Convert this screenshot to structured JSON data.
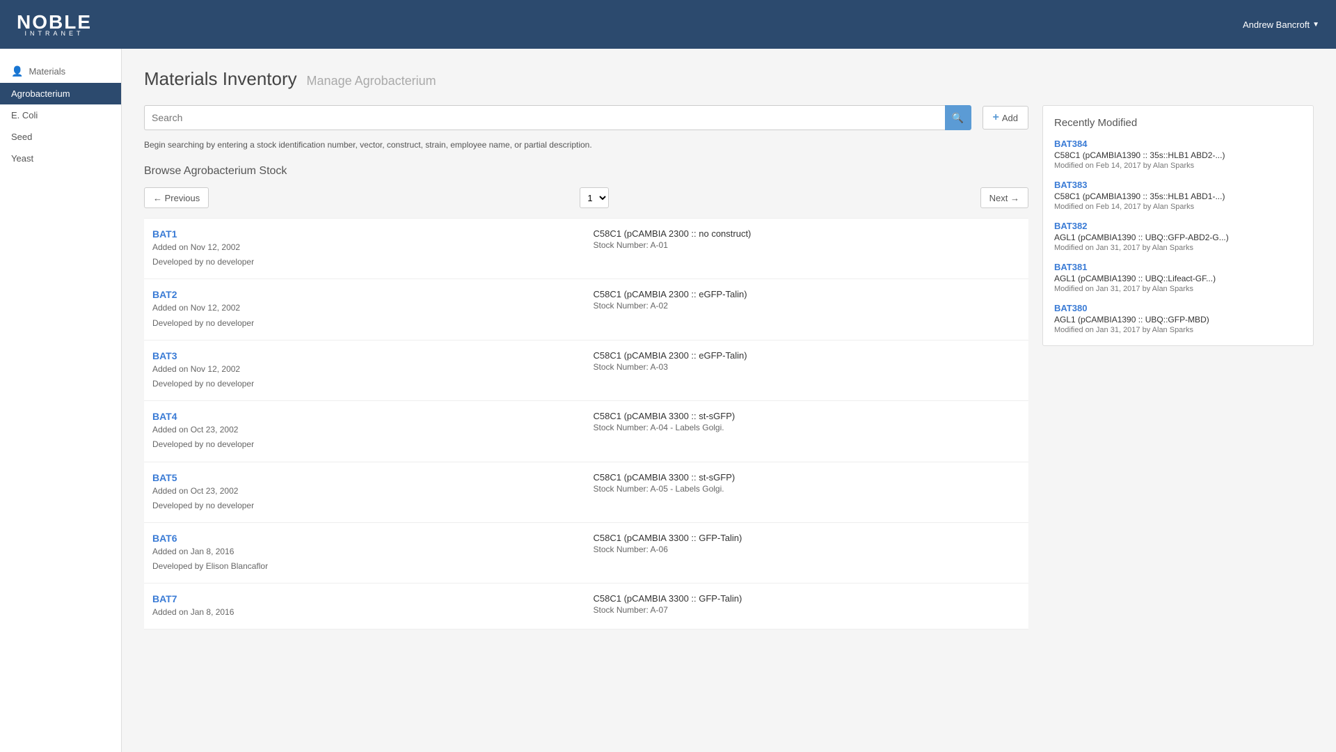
{
  "header": {
    "logo_main": "NOBLE",
    "logo_sub": "INTRANET",
    "user_name": "Andrew Bancroft",
    "user_caret": "▼"
  },
  "sidebar": {
    "section_label": "Materials",
    "items": [
      {
        "id": "agrobacterium",
        "label": "Agrobacterium",
        "active": true
      },
      {
        "id": "ecoli",
        "label": "E. Coli",
        "active": false
      },
      {
        "id": "seed",
        "label": "Seed",
        "active": false
      },
      {
        "id": "yeast",
        "label": "Yeast",
        "active": false
      }
    ]
  },
  "page": {
    "title": "Materials Inventory",
    "subtitle": "Manage Agrobacterium"
  },
  "search": {
    "placeholder": "Search",
    "hint": "Begin searching by entering a stock identification number, vector, construct, strain, employee name, or partial description.",
    "add_label": "Add"
  },
  "browse": {
    "header": "Browse Agrobacterium Stock",
    "prev_label": "← Previous",
    "next_label": "Next →",
    "page_value": "1"
  },
  "stocks": [
    {
      "id": "BAT1",
      "added": "Added on Nov 12, 2002",
      "developer": "Developed by no developer",
      "desc": "C58C1 (pCAMBIA 2300 :: no construct)",
      "stock_number": "Stock Number: A-01"
    },
    {
      "id": "BAT2",
      "added": "Added on Nov 12, 2002",
      "developer": "Developed by no developer",
      "desc": "C58C1 (pCAMBIA 2300 :: eGFP-Talin)",
      "stock_number": "Stock Number: A-02"
    },
    {
      "id": "BAT3",
      "added": "Added on Nov 12, 2002",
      "developer": "Developed by no developer",
      "desc": "C58C1 (pCAMBIA 2300 :: eGFP-Talin)",
      "stock_number": "Stock Number: A-03"
    },
    {
      "id": "BAT4",
      "added": "Added on Oct 23, 2002",
      "developer": "Developed by no developer",
      "desc": "C58C1 (pCAMBIA 3300 :: st-sGFP)",
      "stock_number": "Stock Number: A-04 - Labels Golgi."
    },
    {
      "id": "BAT5",
      "added": "Added on Oct 23, 2002",
      "developer": "Developed by no developer",
      "desc": "C58C1 (pCAMBIA 3300 :: st-sGFP)",
      "stock_number": "Stock Number: A-05 - Labels Golgi."
    },
    {
      "id": "BAT6",
      "added": "Added on Jan 8, 2016",
      "developer": "Developed by Elison Blancaflor",
      "desc": "C58C1 (pCAMBIA 3300 :: GFP-Talin)",
      "stock_number": "Stock Number: A-06"
    },
    {
      "id": "BAT7",
      "added": "Added on Jan 8, 2016",
      "developer": "",
      "desc": "C58C1 (pCAMBIA 3300 :: GFP-Talin)",
      "stock_number": "Stock Number: A-07"
    }
  ],
  "recently_modified": {
    "header": "Recently Modified",
    "items": [
      {
        "id": "BAT384",
        "desc": "C58C1 (pCAMBIA1390 :: 35s::HLB1 ABD2-...)",
        "date": "Modified on Feb 14, 2017 by Alan Sparks"
      },
      {
        "id": "BAT383",
        "desc": "C58C1 (pCAMBIA1390 :: 35s::HLB1 ABD1-...)",
        "date": "Modified on Feb 14, 2017 by Alan Sparks"
      },
      {
        "id": "BAT382",
        "desc": "AGL1 (pCAMBIA1390 :: UBQ::GFP-ABD2-G...)",
        "date": "Modified on Jan 31, 2017 by Alan Sparks"
      },
      {
        "id": "BAT381",
        "desc": "AGL1 (pCAMBIA1390 :: UBQ::Lifeact-GF...)",
        "date": "Modified on Jan 31, 2017 by Alan Sparks"
      },
      {
        "id": "BAT380",
        "desc": "AGL1 (pCAMBIA1390 :: UBQ::GFP-MBD)",
        "date": "Modified on Jan 31, 2017 by Alan Sparks"
      }
    ]
  }
}
